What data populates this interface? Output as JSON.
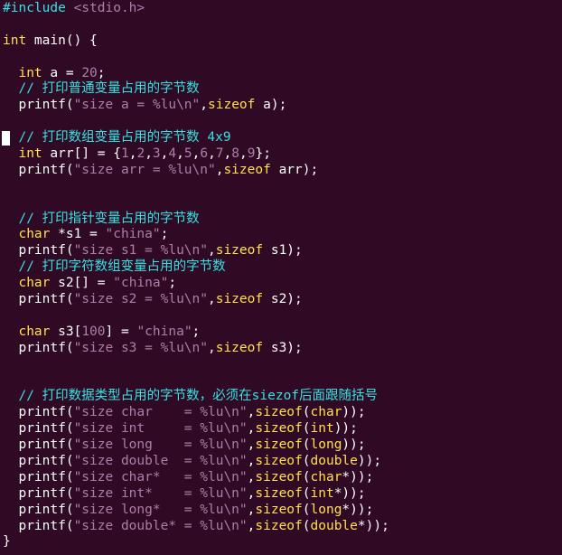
{
  "editor": {
    "background": "#300a24",
    "colors": {
      "type": "#ffe14d",
      "string": "#ad7fa8",
      "number": "#ad7fa8",
      "comment": "#34e2e2",
      "preproc": "#34e2e2",
      "plain": "#ffffff"
    },
    "cursor_line": 9,
    "lines": [
      [
        [
          "preproc",
          "#include"
        ],
        [
          "plain",
          " "
        ],
        [
          "include",
          "<stdio.h>"
        ]
      ],
      [],
      [
        [
          "type",
          "int"
        ],
        [
          "plain",
          " main() {"
        ]
      ],
      [],
      [
        [
          "plain",
          "  "
        ],
        [
          "type",
          "int"
        ],
        [
          "plain",
          " a = "
        ],
        [
          "num",
          "20"
        ],
        [
          "plain",
          ";"
        ]
      ],
      [
        [
          "plain",
          "  "
        ],
        [
          "comment",
          "// 打印普通变量占用的字节数"
        ]
      ],
      [
        [
          "plain",
          "  printf("
        ],
        [
          "str",
          "\"size a = %lu\\n\""
        ],
        [
          "plain",
          ","
        ],
        [
          "kw",
          "sizeof"
        ],
        [
          "plain",
          " a);"
        ]
      ],
      [],
      [
        [
          "plain",
          "  "
        ],
        [
          "comment",
          "// 打印数组变量占用的字节数 4x9"
        ]
      ],
      [
        [
          "plain",
          "  "
        ],
        [
          "type",
          "int"
        ],
        [
          "plain",
          " arr[] = {"
        ],
        [
          "num",
          "1"
        ],
        [
          "plain",
          ","
        ],
        [
          "num",
          "2"
        ],
        [
          "plain",
          ","
        ],
        [
          "num",
          "3"
        ],
        [
          "plain",
          ","
        ],
        [
          "num",
          "4"
        ],
        [
          "plain",
          ","
        ],
        [
          "num",
          "5"
        ],
        [
          "plain",
          ","
        ],
        [
          "num",
          "6"
        ],
        [
          "plain",
          ","
        ],
        [
          "num",
          "7"
        ],
        [
          "plain",
          ","
        ],
        [
          "num",
          "8"
        ],
        [
          "plain",
          ","
        ],
        [
          "num",
          "9"
        ],
        [
          "plain",
          "};"
        ]
      ],
      [
        [
          "plain",
          "  printf("
        ],
        [
          "str",
          "\"size arr = %lu\\n\""
        ],
        [
          "plain",
          ","
        ],
        [
          "kw",
          "sizeof"
        ],
        [
          "plain",
          " arr);"
        ]
      ],
      [],
      [],
      [
        [
          "plain",
          "  "
        ],
        [
          "comment",
          "// 打印指针变量占用的字节数"
        ]
      ],
      [
        [
          "plain",
          "  "
        ],
        [
          "type",
          "char"
        ],
        [
          "plain",
          " *s1 = "
        ],
        [
          "str",
          "\"china\""
        ],
        [
          "plain",
          ";"
        ]
      ],
      [
        [
          "plain",
          "  printf("
        ],
        [
          "str",
          "\"size s1 = %lu\\n\""
        ],
        [
          "plain",
          ","
        ],
        [
          "kw",
          "sizeof"
        ],
        [
          "plain",
          " s1);"
        ]
      ],
      [
        [
          "plain",
          "  "
        ],
        [
          "comment",
          "// 打印字符数组变量占用的字节数"
        ]
      ],
      [
        [
          "plain",
          "  "
        ],
        [
          "type",
          "char"
        ],
        [
          "plain",
          " s2[] = "
        ],
        [
          "str",
          "\"china\""
        ],
        [
          "plain",
          ";"
        ]
      ],
      [
        [
          "plain",
          "  printf("
        ],
        [
          "str",
          "\"size s2 = %lu\\n\""
        ],
        [
          "plain",
          ","
        ],
        [
          "kw",
          "sizeof"
        ],
        [
          "plain",
          " s2);"
        ]
      ],
      [],
      [
        [
          "plain",
          "  "
        ],
        [
          "type",
          "char"
        ],
        [
          "plain",
          " s3["
        ],
        [
          "num",
          "100"
        ],
        [
          "plain",
          "] = "
        ],
        [
          "str",
          "\"china\""
        ],
        [
          "plain",
          ";"
        ]
      ],
      [
        [
          "plain",
          "  printf("
        ],
        [
          "str",
          "\"size s3 = %lu\\n\""
        ],
        [
          "plain",
          ","
        ],
        [
          "kw",
          "sizeof"
        ],
        [
          "plain",
          " s3);"
        ]
      ],
      [],
      [],
      [
        [
          "plain",
          "  "
        ],
        [
          "comment",
          "// 打印数据类型占用的字节数，必须在siezof后面跟随括号"
        ]
      ],
      [
        [
          "plain",
          "  printf("
        ],
        [
          "str",
          "\"size char    = %lu\\n\""
        ],
        [
          "plain",
          ","
        ],
        [
          "kw",
          "sizeof"
        ],
        [
          "plain",
          "("
        ],
        [
          "type",
          "char"
        ],
        [
          "plain",
          "));"
        ]
      ],
      [
        [
          "plain",
          "  printf("
        ],
        [
          "str",
          "\"size int     = %lu\\n\""
        ],
        [
          "plain",
          ","
        ],
        [
          "kw",
          "sizeof"
        ],
        [
          "plain",
          "("
        ],
        [
          "type",
          "int"
        ],
        [
          "plain",
          "));"
        ]
      ],
      [
        [
          "plain",
          "  printf("
        ],
        [
          "str",
          "\"size long    = %lu\\n\""
        ],
        [
          "plain",
          ","
        ],
        [
          "kw",
          "sizeof"
        ],
        [
          "plain",
          "("
        ],
        [
          "type",
          "long"
        ],
        [
          "plain",
          "));"
        ]
      ],
      [
        [
          "plain",
          "  printf("
        ],
        [
          "str",
          "\"size double  = %lu\\n\""
        ],
        [
          "plain",
          ","
        ],
        [
          "kw",
          "sizeof"
        ],
        [
          "plain",
          "("
        ],
        [
          "type",
          "double"
        ],
        [
          "plain",
          "));"
        ]
      ],
      [
        [
          "plain",
          "  printf("
        ],
        [
          "str",
          "\"size char*   = %lu\\n\""
        ],
        [
          "plain",
          ","
        ],
        [
          "kw",
          "sizeof"
        ],
        [
          "plain",
          "("
        ],
        [
          "type",
          "char"
        ],
        [
          "plain",
          "*));"
        ]
      ],
      [
        [
          "plain",
          "  printf("
        ],
        [
          "str",
          "\"size int*    = %lu\\n\""
        ],
        [
          "plain",
          ","
        ],
        [
          "kw",
          "sizeof"
        ],
        [
          "plain",
          "("
        ],
        [
          "type",
          "int"
        ],
        [
          "plain",
          "*));"
        ]
      ],
      [
        [
          "plain",
          "  printf("
        ],
        [
          "str",
          "\"size long*   = %lu\\n\""
        ],
        [
          "plain",
          ","
        ],
        [
          "kw",
          "sizeof"
        ],
        [
          "plain",
          "("
        ],
        [
          "type",
          "long"
        ],
        [
          "plain",
          "*));"
        ]
      ],
      [
        [
          "plain",
          "  printf("
        ],
        [
          "str",
          "\"size double* = %lu\\n\""
        ],
        [
          "plain",
          ","
        ],
        [
          "kw",
          "sizeof"
        ],
        [
          "plain",
          "("
        ],
        [
          "type",
          "double"
        ],
        [
          "plain",
          "*));"
        ]
      ],
      [
        [
          "plain",
          "}"
        ]
      ]
    ]
  }
}
